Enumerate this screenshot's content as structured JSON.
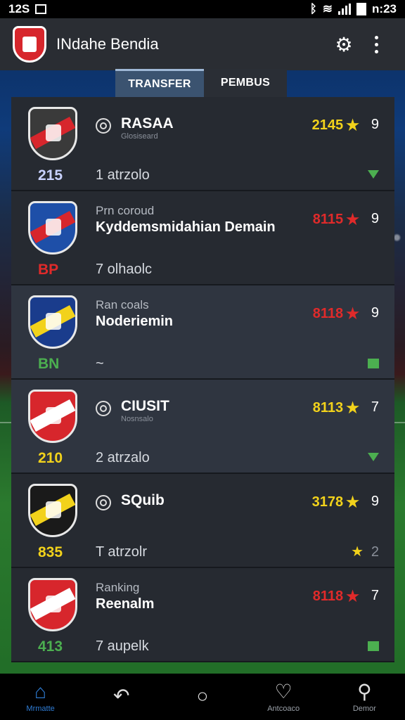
{
  "status_bar": {
    "time_left": "12S",
    "time_right": "n:23"
  },
  "app_bar": {
    "title": "INdahe Bendia"
  },
  "tabs": [
    {
      "label": "TRANSFER",
      "active": true
    },
    {
      "label": "PEMBUS",
      "active": false
    }
  ],
  "rows": [
    {
      "code": "215",
      "code_color": "#c9d2ff",
      "label": "",
      "name": "RASAA",
      "subname": "Glosiseard",
      "score": "2145",
      "score_color": "#f2d21b",
      "score_num": "9",
      "sub_count": "1 atrzolo",
      "indicator": "tri",
      "crest": [
        "#3a3a3a",
        "#d7262c"
      ],
      "shade": "dark",
      "has_icon": true
    },
    {
      "code": "BP",
      "code_color": "#e02a2a",
      "label": "Prn coroud",
      "name": "Kyddemsmidahian Demain",
      "subname": "",
      "score": "8115",
      "score_color": "#e02a2a",
      "score_num": "9",
      "sub_count": "7 olhaolc",
      "indicator": "",
      "crest": [
        "#1e4fa8",
        "#d7262c"
      ],
      "shade": "dark",
      "has_icon": false
    },
    {
      "code": "BN",
      "code_color": "#4caf50",
      "label": "Ran coals",
      "name": "Noderiemin",
      "subname": "",
      "score": "8118",
      "score_color": "#e02a2a",
      "score_num": "9",
      "sub_count": "~",
      "indicator": "sq",
      "crest": [
        "#1a3c8c",
        "#f2d21b"
      ],
      "shade": "light",
      "has_icon": false
    },
    {
      "code": "210",
      "code_color": "#f2d21b",
      "label": "",
      "name": "CIUSIT",
      "subname": "Nosnsalo",
      "score": "8113",
      "score_color": "#f2d21b",
      "score_num": "7",
      "sub_count": "2 atrzalo",
      "indicator": "tri",
      "crest": [
        "#d7262c",
        "#ffffff"
      ],
      "shade": "light",
      "has_icon": true
    },
    {
      "code": "835",
      "code_color": "#f2d21b",
      "label": "",
      "name": "SQuib",
      "subname": "",
      "score": "3178",
      "score_color": "#f2d21b",
      "score_num": "9",
      "sub_count": "T atrzolr",
      "indicator": "star",
      "indicator_num": "2",
      "crest": [
        "#1a1a1a",
        "#f2d21b"
      ],
      "shade": "dark",
      "has_icon": true
    },
    {
      "code": "413",
      "code_color": "#4caf50",
      "label": "Ranking",
      "name": "Reenalm",
      "subname": "",
      "score": "8118",
      "score_color": "#e02a2a",
      "score_num": "7",
      "sub_count": "7 aupelk",
      "indicator": "sq",
      "crest": [
        "#d7262c",
        "#ffffff"
      ],
      "shade": "dark",
      "has_icon": false
    }
  ],
  "nav": [
    {
      "label": "Mrmatte",
      "icon": "home-icon",
      "active": true
    },
    {
      "label": "",
      "icon": "back-icon",
      "active": false
    },
    {
      "label": "",
      "icon": "circle-icon",
      "active": false
    },
    {
      "label": "Antcoaco",
      "icon": "heart-icon",
      "active": false
    },
    {
      "label": "Demor",
      "icon": "search-icon",
      "active": false
    }
  ]
}
